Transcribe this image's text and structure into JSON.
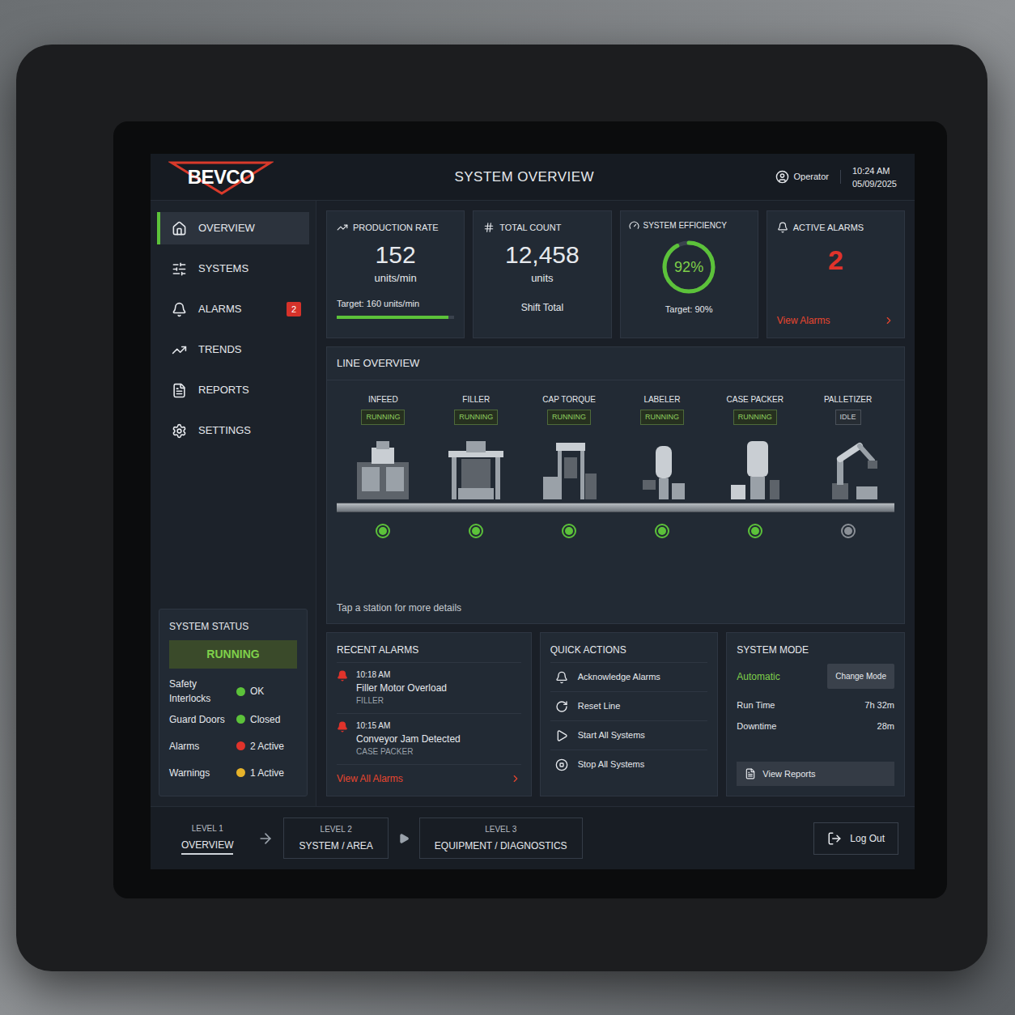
{
  "header": {
    "logo": "BEVCO",
    "title": "SYSTEM OVERVIEW",
    "user": "Operator",
    "time": "10:24 AM",
    "date": "05/09/2025"
  },
  "sidebar": {
    "items": [
      {
        "label": "OVERVIEW",
        "selected": true,
        "badge": ""
      },
      {
        "label": "SYSTEMS",
        "selected": false,
        "badge": ""
      },
      {
        "label": "ALARMS",
        "selected": false,
        "badge": "2"
      },
      {
        "label": "TRENDS",
        "selected": false,
        "badge": ""
      },
      {
        "label": "REPORTS",
        "selected": false,
        "badge": ""
      },
      {
        "label": "SETTINGS",
        "selected": false,
        "badge": ""
      }
    ]
  },
  "system_status": {
    "title": "SYSTEM STATUS",
    "state": "RUNNING",
    "rows": [
      {
        "label": "Safety Interlocks",
        "value": "OK",
        "color": "#5cc23a"
      },
      {
        "label": "Guard Doors",
        "value": "Closed",
        "color": "#5cc23a"
      },
      {
        "label": "Alarms",
        "value": "2 Active",
        "color": "#e0332b"
      },
      {
        "label": "Warnings",
        "value": "1 Active",
        "color": "#e6b32a"
      }
    ]
  },
  "kpis": {
    "production_rate": {
      "title": "PRODUCTION RATE",
      "value": "152",
      "unit": "units/min",
      "target": "Target: 160 units/min",
      "level": 0.95
    },
    "total_count": {
      "title": "TOTAL COUNT",
      "value": "12,458",
      "unit": "units",
      "note": "Shift Total"
    },
    "efficiency": {
      "title": "SYSTEM EFFICIENCY",
      "value": "92%",
      "target": "Target: 90%",
      "level": 0.92
    },
    "active_alarms": {
      "title": "ACTIVE ALARMS",
      "value": "2",
      "link": "View Alarms"
    }
  },
  "line_overview": {
    "title": "LINE OVERVIEW",
    "hint": "Tap a station for more details",
    "stations": [
      {
        "name": "INFEED",
        "status": "RUNNING",
        "running": true,
        "color": "#5cc23a"
      },
      {
        "name": "FILLER",
        "status": "RUNNING",
        "running": true,
        "color": "#5cc23a"
      },
      {
        "name": "CAP TORQUE",
        "status": "RUNNING",
        "running": true,
        "color": "#5cc23a"
      },
      {
        "name": "LABELER",
        "status": "RUNNING",
        "running": true,
        "color": "#5cc23a"
      },
      {
        "name": "CASE PACKER",
        "status": "RUNNING",
        "running": true,
        "color": "#5cc23a"
      },
      {
        "name": "PALLETIZER",
        "status": "IDLE",
        "running": false,
        "color": "#8a8f96"
      }
    ]
  },
  "recent_alarms": {
    "title": "RECENT ALARMS",
    "items": [
      {
        "time": "10:18 AM",
        "message": "Filler Motor Overload",
        "source": "FILLER"
      },
      {
        "time": "10:15 AM",
        "message": "Conveyor Jam Detected",
        "source": "CASE PACKER"
      }
    ],
    "link": "View All Alarms"
  },
  "quick_actions": {
    "title": "QUICK ACTIONS",
    "items": [
      "Acknowledge Alarms",
      "Reset Line",
      "Start All Systems",
      "Stop All Systems"
    ]
  },
  "system_mode": {
    "title": "SYSTEM MODE",
    "mode": "Automatic",
    "button": "Change Mode",
    "rows": [
      {
        "label": "Run Time",
        "value": "7h 32m"
      },
      {
        "label": "Downtime",
        "value": "28m"
      }
    ],
    "reports_button": "View Reports"
  },
  "breadcrumbs": [
    {
      "level": "LEVEL 1",
      "label": "OVERVIEW",
      "selected": true
    },
    {
      "level": "LEVEL 2",
      "label": "SYSTEM / AREA",
      "selected": false
    },
    {
      "level": "LEVEL 3",
      "label": "EQUIPMENT / DIAGNOSTICS",
      "selected": false
    }
  ],
  "logout": "Log Out"
}
